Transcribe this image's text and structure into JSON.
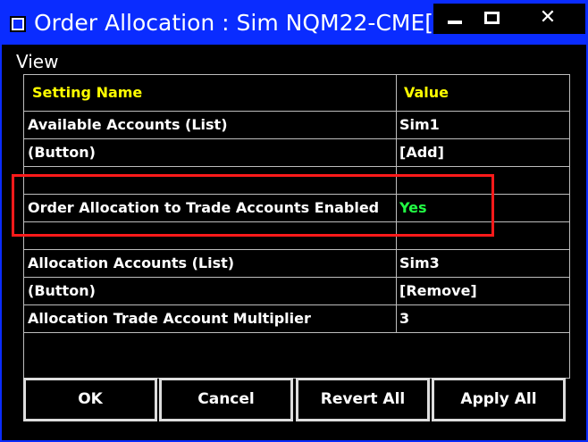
{
  "window": {
    "title": "Order Allocation : Sim NQM22-CME[...",
    "minimize_icon": "minimize-icon",
    "maximize_icon": "maximize-icon",
    "close_glyph": "✕"
  },
  "menu": {
    "view_label": "View"
  },
  "grid": {
    "header": {
      "name": "Setting Name",
      "value": "Value"
    },
    "rows": [
      {
        "name": "Available Accounts (List)",
        "value": "Sim1"
      },
      {
        "name": " (Button)",
        "value": "[Add]"
      },
      {
        "name": "",
        "value": ""
      },
      {
        "name": "Order Allocation to Trade Accounts Enabled",
        "value": "Yes"
      },
      {
        "name": "",
        "value": ""
      },
      {
        "name": "Allocation Accounts (List)",
        "value": "Sim3"
      },
      {
        "name": " (Button)",
        "value": "[Remove]"
      },
      {
        "name": "Allocation Trade Account Multiplier",
        "value": "3"
      }
    ]
  },
  "buttons": {
    "ok": "OK",
    "cancel": "Cancel",
    "revert_all": "Revert All",
    "apply_all": "Apply All"
  },
  "colors": {
    "titlebar": "#0a2cff",
    "header_text": "#ffff00",
    "yes_value": "#22ff44",
    "highlight": "#ff1a1a"
  }
}
